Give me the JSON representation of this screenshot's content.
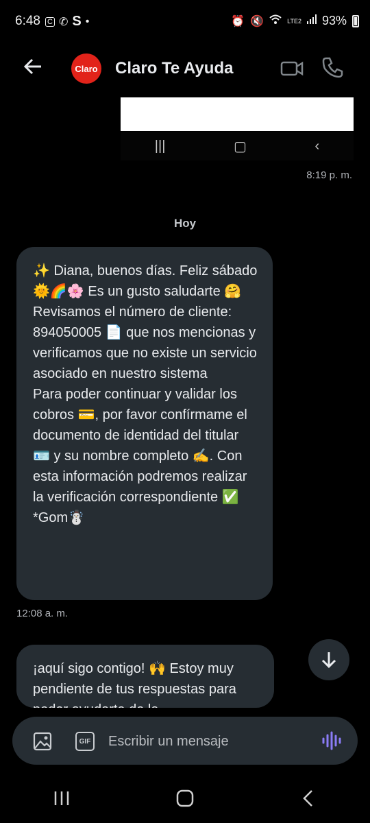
{
  "status_bar": {
    "time": "6:48",
    "left_icons": [
      "carrier-badge-icon",
      "whatsapp-icon",
      "s-app-icon",
      "dot-icon"
    ],
    "battery_percent": "93%",
    "network_label": "LTE2"
  },
  "header": {
    "logo_text": "Claro",
    "title": "Claro Te Ayuda"
  },
  "earlier_message": {
    "timestamp": "8:19 p. m."
  },
  "day_separator": "Hoy",
  "messages": [
    {
      "paragraph_1": "✨ Diana, buenos días. Feliz sábado 🌞🌈🌸 Es un gusto saludarte 🤗 Revisamos el número de cliente: 894050005 📄 que nos mencionas y verificamos que no existe un servicio asociado en nuestro sistema",
      "paragraph_2": "Para poder continuar y validar los cobros 💳, por favor confírmame el documento de identidad del titular 🪪 y su nombre completo ✍️. Con esta información podremos realizar la verificación correspondiente ✅ *Gom☃️",
      "timestamp": "12:08 a. m."
    },
    {
      "text": "¡aquí sigo contigo! 🙌 Estoy muy pendiente de tus respuestas para poder ayudarte de la"
    }
  ],
  "composer": {
    "placeholder": "Escribir un mensaje",
    "gif_label": "GIF"
  },
  "colors": {
    "bubble": "#262d33",
    "background": "#000000",
    "brand": "#e2231a",
    "voice_accent": "#8b7cf6"
  }
}
